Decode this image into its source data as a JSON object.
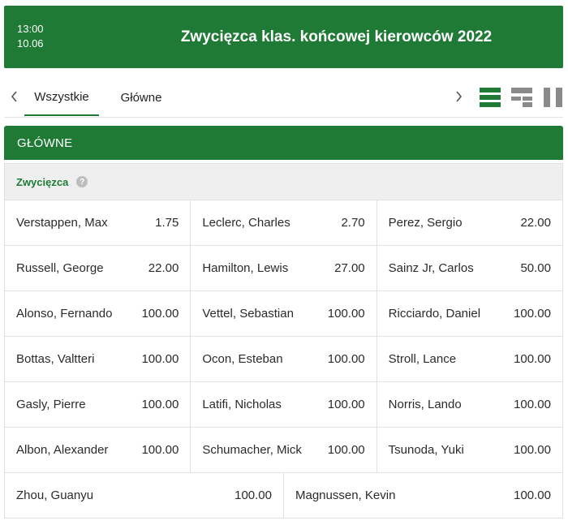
{
  "event": {
    "time": "13:00",
    "date": "10.06",
    "title": "Zwycięzca klas. końcowej kierowców 2022"
  },
  "tabs": [
    {
      "label": "Wszystkie",
      "active": true
    },
    {
      "label": "Główne",
      "active": false
    }
  ],
  "icons": {
    "left": "chevron-left-icon",
    "right": "chevron-right-icon",
    "views": [
      "list-view-icon",
      "grid-view-icon",
      "column-view-icon"
    ]
  },
  "colors": {
    "brand": "#1e7a34",
    "inactive_icon": "#8a8a8a"
  },
  "section": {
    "title": "GŁÓWNE"
  },
  "market": {
    "name": "Zwycięzca",
    "help": "?",
    "rows": [
      [
        {
          "name": "Verstappen, Max",
          "odds": "1.75"
        },
        {
          "name": "Leclerc, Charles",
          "odds": "2.70"
        },
        {
          "name": "Perez, Sergio",
          "odds": "22.00"
        }
      ],
      [
        {
          "name": "Russell, George",
          "odds": "22.00"
        },
        {
          "name": "Hamilton, Lewis",
          "odds": "27.00"
        },
        {
          "name": "Sainz Jr, Carlos",
          "odds": "50.00"
        }
      ],
      [
        {
          "name": "Alonso, Fernando",
          "odds": "100.00"
        },
        {
          "name": "Vettel, Sebastian",
          "odds": "100.00"
        },
        {
          "name": "Ricciardo, Daniel",
          "odds": "100.00"
        }
      ],
      [
        {
          "name": "Bottas, Valtteri",
          "odds": "100.00"
        },
        {
          "name": "Ocon, Esteban",
          "odds": "100.00"
        },
        {
          "name": "Stroll, Lance",
          "odds": "100.00"
        }
      ],
      [
        {
          "name": "Gasly, Pierre",
          "odds": "100.00"
        },
        {
          "name": "Latifi, Nicholas",
          "odds": "100.00"
        },
        {
          "name": "Norris, Lando",
          "odds": "100.00"
        }
      ],
      [
        {
          "name": "Albon, Alexander",
          "odds": "100.00"
        },
        {
          "name": "Schumacher, Mick",
          "odds": "100.00"
        },
        {
          "name": "Tsunoda, Yuki",
          "odds": "100.00"
        }
      ],
      [
        {
          "name": "Zhou, Guanyu",
          "odds": "100.00"
        },
        {
          "name": "Magnussen, Kevin",
          "odds": "100.00"
        }
      ]
    ]
  }
}
